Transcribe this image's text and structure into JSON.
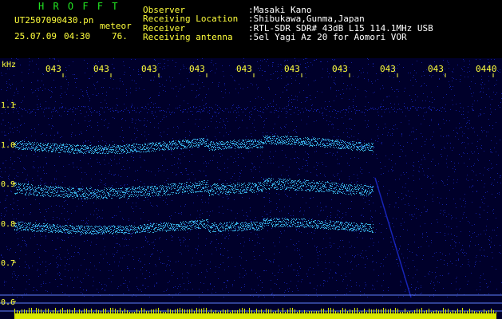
{
  "header": {
    "brand": "H R O F F T",
    "filename": "UT2507090430.pn",
    "subtitle": "meteor",
    "date": "25.07.09",
    "time": "04:30",
    "value": "76.",
    "labels": [
      {
        "key": "Observer",
        "value": ":Masaki Kano"
      },
      {
        "key": "Receiving Location",
        "value": ":Shibukawa,Gunma,Japan"
      },
      {
        "key": "Receiver",
        "value": ":RTL-SDR SDR# 43dB L15 114.1MHz USB"
      },
      {
        "key": "Receiving antenna",
        "value": ":5el Yagi Az 20 for Aomori VOR"
      }
    ]
  },
  "spectrogram": {
    "yunit": "kHz",
    "yticks": [
      "1.1",
      "1.0",
      "0.9",
      "0.8",
      "0.7",
      "0.6"
    ],
    "xticks": [
      "043",
      "043",
      "043",
      "043",
      "043",
      "043",
      "043",
      "043",
      "043",
      "0440"
    ],
    "colors": {
      "background": "#00002a",
      "noise": "#1a28c8",
      "signal": "#40c8ff",
      "bottom_bar": "#d8e800",
      "hline": "#6080ff"
    }
  }
}
